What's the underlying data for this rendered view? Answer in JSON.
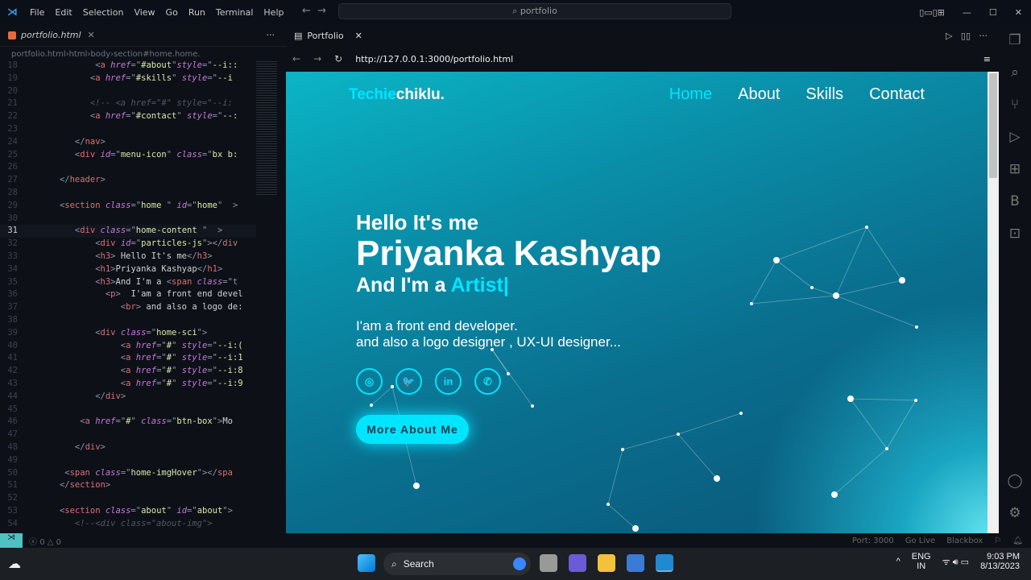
{
  "menu": [
    "File",
    "Edit",
    "Selection",
    "View",
    "Go",
    "Run",
    "Terminal",
    "Help"
  ],
  "command_center": "portfolio",
  "editor": {
    "tab": "portfolio.html",
    "breadcrumb": [
      "portfolio.html",
      "html",
      "body",
      "section#home.home."
    ],
    "current_line": 31,
    "lines": [
      {
        "n": 18,
        "i": 9,
        "t": [
          [
            "p",
            "<"
          ],
          [
            "tag",
            "a "
          ],
          [
            "attr",
            "href"
          ],
          [
            "p",
            "=\""
          ],
          [
            "str",
            "#about"
          ],
          [
            "p",
            "\""
          ],
          [
            "attr",
            "style"
          ],
          [
            "p",
            "=\""
          ],
          [
            "str",
            "--i::"
          ]
        ]
      },
      {
        "n": 19,
        "i": 8,
        "t": [
          [
            "p",
            "<"
          ],
          [
            "tag",
            "a "
          ],
          [
            "attr",
            "href"
          ],
          [
            "p",
            "=\""
          ],
          [
            "str",
            "#skills"
          ],
          [
            "p",
            "\" "
          ],
          [
            "attr",
            "style"
          ],
          [
            "p",
            "=\""
          ],
          [
            "str",
            "--i"
          ]
        ]
      },
      {
        "n": 20,
        "i": 0,
        "t": []
      },
      {
        "n": 21,
        "i": 8,
        "t": [
          [
            "com",
            "<!-- <a href=\"#\" style=\"--i:"
          ]
        ]
      },
      {
        "n": 22,
        "i": 8,
        "t": [
          [
            "p",
            "<"
          ],
          [
            "tag",
            "a "
          ],
          [
            "attr",
            "href"
          ],
          [
            "p",
            "=\""
          ],
          [
            "str",
            "#contact"
          ],
          [
            "p",
            "\" "
          ],
          [
            "attr",
            "style"
          ],
          [
            "p",
            "=\""
          ],
          [
            "str",
            "--:"
          ]
        ]
      },
      {
        "n": 23,
        "i": 0,
        "t": []
      },
      {
        "n": 24,
        "i": 6,
        "t": [
          [
            "p",
            "</"
          ],
          [
            "tag",
            "nav"
          ],
          [
            "p",
            ">"
          ]
        ]
      },
      {
        "n": 25,
        "i": 6,
        "t": [
          [
            "p",
            "<"
          ],
          [
            "tag",
            "div "
          ],
          [
            "attr",
            "id"
          ],
          [
            "p",
            "=\""
          ],
          [
            "str",
            "menu-icon"
          ],
          [
            "p",
            "\" "
          ],
          [
            "attr",
            "class"
          ],
          [
            "p",
            "=\""
          ],
          [
            "str",
            "bx b:"
          ]
        ]
      },
      {
        "n": 26,
        "i": 0,
        "t": []
      },
      {
        "n": 27,
        "i": 4,
        "t": [
          [
            "p",
            "</"
          ],
          [
            "tag",
            "header"
          ],
          [
            "p",
            ">"
          ]
        ]
      },
      {
        "n": 28,
        "i": 0,
        "t": []
      },
      {
        "n": 29,
        "i": 4,
        "t": [
          [
            "p",
            "<"
          ],
          [
            "tag",
            "section "
          ],
          [
            "attr",
            "class"
          ],
          [
            "p",
            "=\""
          ],
          [
            "str",
            "home "
          ],
          [
            "p",
            "\" "
          ],
          [
            "attr",
            "id"
          ],
          [
            "p",
            "=\""
          ],
          [
            "str",
            "home"
          ],
          [
            "p",
            "\"  >"
          ]
        ]
      },
      {
        "n": 30,
        "i": 0,
        "t": []
      },
      {
        "n": 31,
        "i": 6,
        "t": [
          [
            "p",
            "<"
          ],
          [
            "tag",
            "div "
          ],
          [
            "attr",
            "class"
          ],
          [
            "p",
            "=\""
          ],
          [
            "str",
            "home-content "
          ],
          [
            "p",
            "\"  >"
          ]
        ]
      },
      {
        "n": 32,
        "i": 9,
        "t": [
          [
            "p",
            "<"
          ],
          [
            "tag",
            "div "
          ],
          [
            "attr",
            "id"
          ],
          [
            "p",
            "=\""
          ],
          [
            "str",
            "particles-js"
          ],
          [
            "p",
            "\"></"
          ],
          [
            "tag",
            "div"
          ]
        ]
      },
      {
        "n": 33,
        "i": 9,
        "t": [
          [
            "p",
            "<"
          ],
          [
            "tag",
            "h3"
          ],
          [
            "p",
            ">"
          ],
          [
            "txt",
            " Hello It's me"
          ],
          [
            "p",
            "</"
          ],
          [
            "tag",
            "h3"
          ],
          [
            "p",
            ">"
          ]
        ]
      },
      {
        "n": 34,
        "i": 9,
        "t": [
          [
            "p",
            "<"
          ],
          [
            "tag",
            "h1"
          ],
          [
            "p",
            ">"
          ],
          [
            "txt",
            "Priyanka Kashyap"
          ],
          [
            "p",
            "</"
          ],
          [
            "tag",
            "h1"
          ],
          [
            "p",
            ">"
          ]
        ]
      },
      {
        "n": 35,
        "i": 9,
        "t": [
          [
            "p",
            "<"
          ],
          [
            "tag",
            "h3"
          ],
          [
            "p",
            ">"
          ],
          [
            "txt",
            "And I'm a "
          ],
          [
            "p",
            "<"
          ],
          [
            "tag",
            "span "
          ],
          [
            "attr",
            "class"
          ],
          [
            "p",
            "=\"t"
          ]
        ]
      },
      {
        "n": 36,
        "i": 10,
        "t": [
          [
            "p",
            "<"
          ],
          [
            "tag",
            "p"
          ],
          [
            "p",
            ">"
          ],
          [
            "txt",
            "  I'am a front end devel"
          ]
        ]
      },
      {
        "n": 37,
        "i": 12,
        "t": [
          [
            "p",
            "<"
          ],
          [
            "tag",
            "br"
          ],
          [
            "p",
            ">"
          ],
          [
            "txt",
            " and also a logo de:"
          ]
        ]
      },
      {
        "n": 38,
        "i": 0,
        "t": []
      },
      {
        "n": 39,
        "i": 9,
        "t": [
          [
            "p",
            "<"
          ],
          [
            "tag",
            "div "
          ],
          [
            "attr",
            "class"
          ],
          [
            "p",
            "=\""
          ],
          [
            "str",
            "home-sci"
          ],
          [
            "p",
            "\">"
          ]
        ]
      },
      {
        "n": 40,
        "i": 12,
        "t": [
          [
            "p",
            "<"
          ],
          [
            "tag",
            "a "
          ],
          [
            "attr",
            "href"
          ],
          [
            "p",
            "=\""
          ],
          [
            "str",
            "#"
          ],
          [
            "p",
            "\" "
          ],
          [
            "attr",
            "style"
          ],
          [
            "p",
            "=\""
          ],
          [
            "str",
            "--i:("
          ]
        ]
      },
      {
        "n": 41,
        "i": 12,
        "t": [
          [
            "p",
            "<"
          ],
          [
            "tag",
            "a "
          ],
          [
            "attr",
            "href"
          ],
          [
            "p",
            "=\""
          ],
          [
            "str",
            "#"
          ],
          [
            "p",
            "\" "
          ],
          [
            "attr",
            "style"
          ],
          [
            "p",
            "=\""
          ],
          [
            "str",
            "--i:1"
          ]
        ]
      },
      {
        "n": 42,
        "i": 12,
        "t": [
          [
            "p",
            "<"
          ],
          [
            "tag",
            "a "
          ],
          [
            "attr",
            "href"
          ],
          [
            "p",
            "=\""
          ],
          [
            "str",
            "#"
          ],
          [
            "p",
            "\" "
          ],
          [
            "attr",
            "style"
          ],
          [
            "p",
            "=\""
          ],
          [
            "str",
            "--i:8"
          ]
        ]
      },
      {
        "n": 43,
        "i": 12,
        "t": [
          [
            "p",
            "<"
          ],
          [
            "tag",
            "a "
          ],
          [
            "attr",
            "href"
          ],
          [
            "p",
            "=\""
          ],
          [
            "str",
            "#"
          ],
          [
            "p",
            "\" "
          ],
          [
            "attr",
            "style"
          ],
          [
            "p",
            "=\""
          ],
          [
            "str",
            "--i:9"
          ]
        ]
      },
      {
        "n": 44,
        "i": 9,
        "t": [
          [
            "p",
            "</"
          ],
          [
            "tag",
            "div"
          ],
          [
            "p",
            ">"
          ]
        ]
      },
      {
        "n": 45,
        "i": 0,
        "t": []
      },
      {
        "n": 46,
        "i": 7,
        "t": [
          [
            "p",
            "<"
          ],
          [
            "tag",
            "a "
          ],
          [
            "attr",
            "href"
          ],
          [
            "p",
            "=\""
          ],
          [
            "str",
            "#"
          ],
          [
            "p",
            "\" "
          ],
          [
            "attr",
            "class"
          ],
          [
            "p",
            "=\""
          ],
          [
            "str",
            "btn-box"
          ],
          [
            "p",
            "\">"
          ],
          [
            "txt",
            "Mo"
          ]
        ]
      },
      {
        "n": 47,
        "i": 0,
        "t": []
      },
      {
        "n": 48,
        "i": 6,
        "t": [
          [
            "p",
            "</"
          ],
          [
            "tag",
            "div"
          ],
          [
            "p",
            ">"
          ]
        ]
      },
      {
        "n": 49,
        "i": 0,
        "t": []
      },
      {
        "n": 50,
        "i": 5,
        "t": [
          [
            "p",
            "<"
          ],
          [
            "tag",
            "span "
          ],
          [
            "attr",
            "class"
          ],
          [
            "p",
            "=\""
          ],
          [
            "str",
            "home-imgHover"
          ],
          [
            "p",
            "\"></"
          ],
          [
            "tag",
            "spa"
          ]
        ]
      },
      {
        "n": 51,
        "i": 4,
        "t": [
          [
            "p",
            "</"
          ],
          [
            "tag",
            "section"
          ],
          [
            "p",
            ">"
          ]
        ]
      },
      {
        "n": 52,
        "i": 0,
        "t": []
      },
      {
        "n": 53,
        "i": 4,
        "t": [
          [
            "p",
            "<"
          ],
          [
            "tag",
            "section "
          ],
          [
            "attr",
            "class"
          ],
          [
            "p",
            "=\""
          ],
          [
            "str",
            "about"
          ],
          [
            "p",
            "\" "
          ],
          [
            "attr",
            "id"
          ],
          [
            "p",
            "=\""
          ],
          [
            "str",
            "about"
          ],
          [
            "p",
            "\">"
          ]
        ]
      },
      {
        "n": 54,
        "i": 6,
        "t": [
          [
            "com",
            "<!--<div class=\"about-img\">"
          ]
        ]
      }
    ]
  },
  "browser": {
    "tab": "Portfolio",
    "url": "http://127.0.0.1:3000/portfolio.html"
  },
  "site": {
    "brand_accent": "Techie",
    "brand_rest": "chiklu.",
    "nav": [
      "Home",
      "About",
      "Skills",
      "Contact"
    ],
    "active_nav": "Home",
    "greeting": "Hello It's me",
    "name": "Priyanka Kashyap",
    "role_prefix": "And I'm a ",
    "role": "Artist|",
    "desc1": "I'am a front end developer.",
    "desc2": "and also a logo designer , UX-UI designer...",
    "social": [
      {
        "icon": "instagram-icon",
        "glyph": "◎"
      },
      {
        "icon": "twitter-icon",
        "glyph": "🐦"
      },
      {
        "icon": "linkedin-icon",
        "glyph": "in"
      },
      {
        "icon": "whatsapp-icon",
        "glyph": "✆"
      }
    ],
    "button": "More About Me",
    "accent": "#00e5ff"
  },
  "status": {
    "errors": "0",
    "warnings": "0",
    "port": "Port: 3000",
    "golive": "Go Live",
    "blackbox": "Blackbox"
  },
  "taskbar": {
    "search": "Search",
    "lang1": "ENG",
    "lang2": "IN",
    "time": "9:03 PM",
    "date": "8/13/2023"
  }
}
